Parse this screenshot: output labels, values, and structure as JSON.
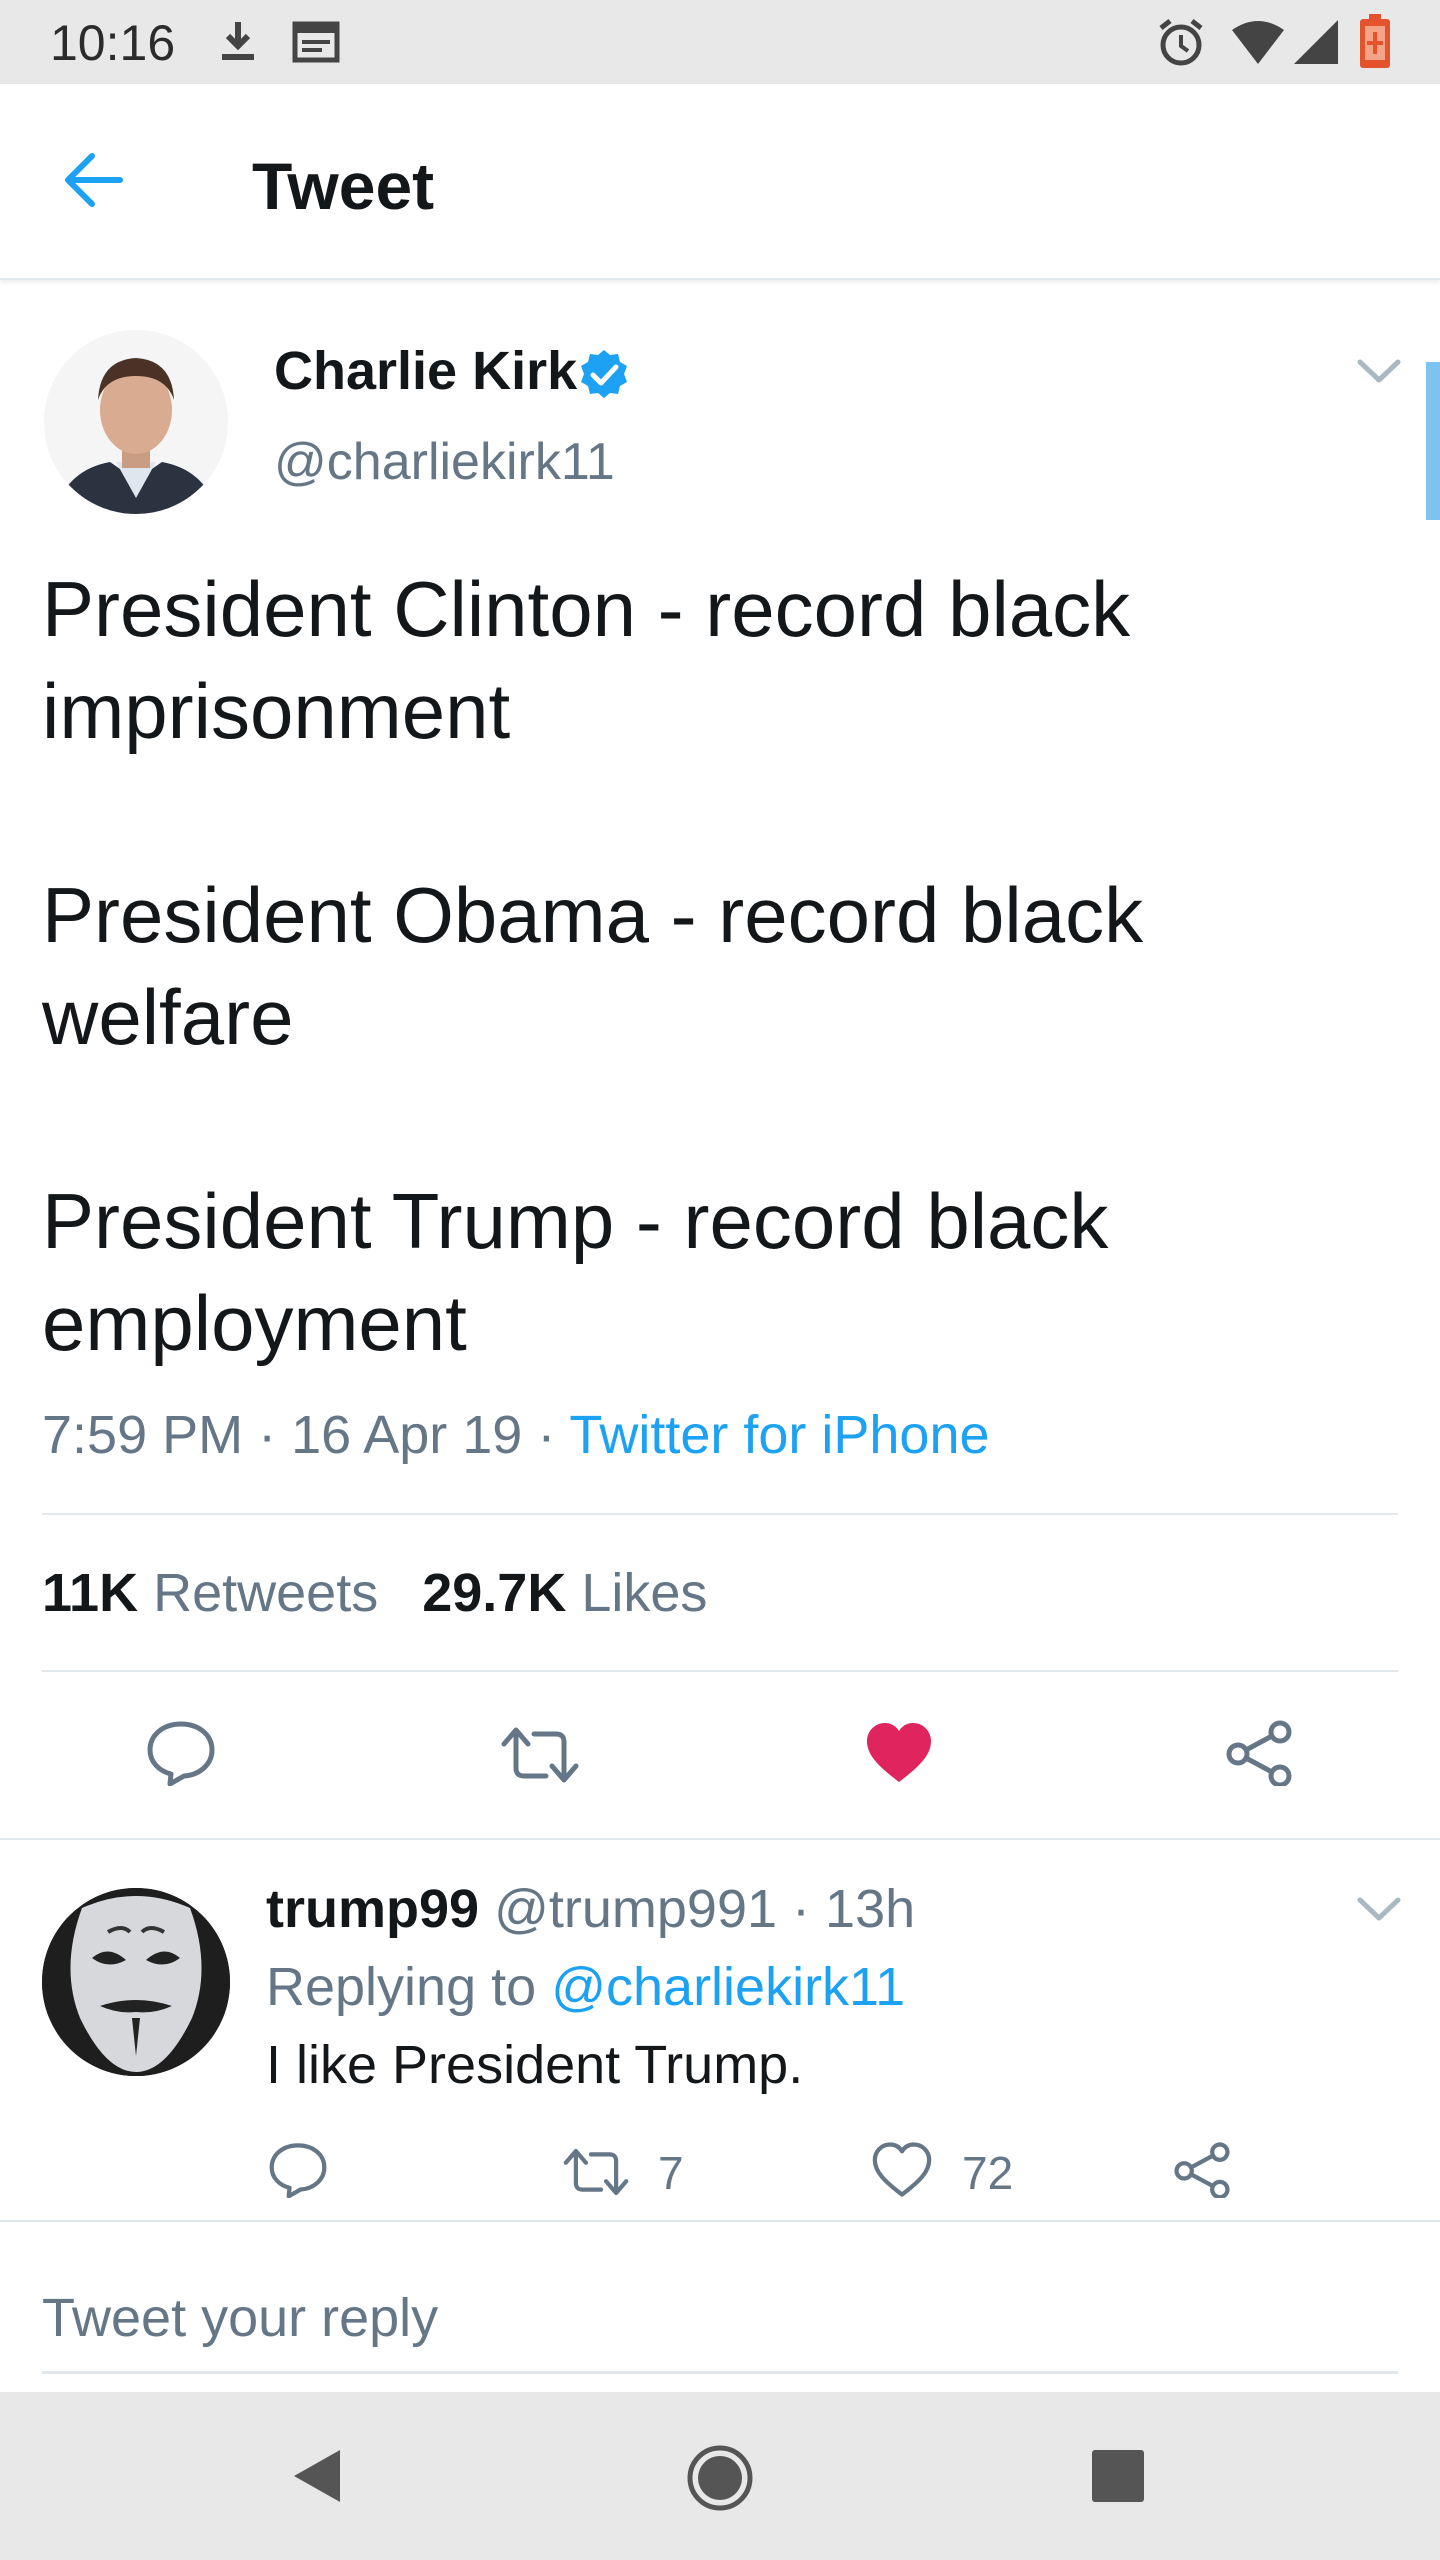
{
  "status_bar": {
    "time": "10:16",
    "icons": [
      "download-icon",
      "calendar-icon",
      "alarm-icon",
      "wifi-icon",
      "signal-icon",
      "battery-icon"
    ]
  },
  "header": {
    "title": "Tweet",
    "back_icon": "arrow-left-icon"
  },
  "tweet": {
    "author_name": "Charlie Kirk",
    "verified": true,
    "author_handle": "@charliekirk11",
    "paragraphs": [
      "President Clinton - record black imprisonment",
      "President Obama - record black welfare",
      "President Trump - record black employment"
    ],
    "time": "7:59 PM",
    "date": "16 Apr 19",
    "source": "Twitter for iPhone",
    "retweets_count": "11K",
    "retweets_label": "Retweets",
    "likes_count": "29.7K",
    "likes_label": "Likes",
    "liked": true
  },
  "reply": {
    "name": "trump99",
    "handle": "@trump991",
    "time": "13h",
    "replying_prefix": "Replying to",
    "replying_to": "@charliekirk11",
    "text": "I like President Trump.",
    "retweets": "7",
    "likes": "72"
  },
  "compose": {
    "placeholder": "Tweet your reply"
  },
  "colors": {
    "accent": "#1da1f2",
    "like": "#e0245e",
    "secondary_text": "#657786",
    "primary_text": "#14171a"
  }
}
